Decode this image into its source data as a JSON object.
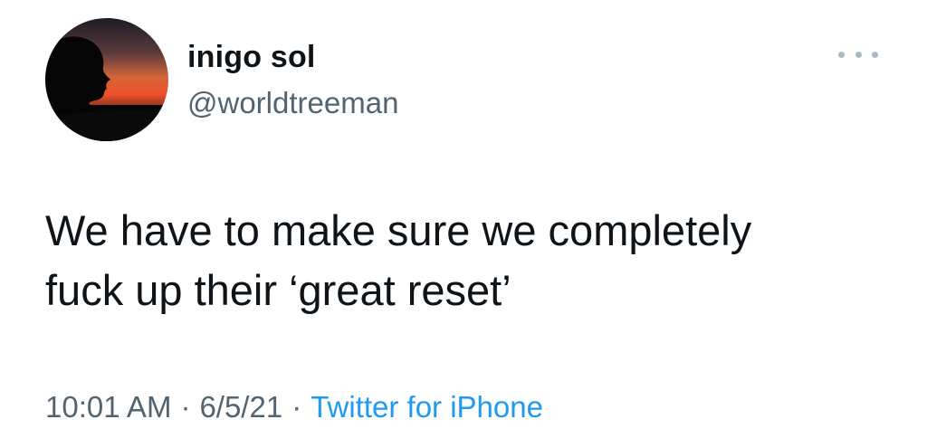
{
  "user": {
    "display_name": "inigo sol",
    "handle": "@worldtreeman",
    "avatar_icon": "silhouette-sunset-avatar"
  },
  "menu": {
    "icon": "more-options-icon"
  },
  "tweet": {
    "text_lines": [
      "We have to make sure we completely",
      "fuck up their ‘great reset’"
    ],
    "time": "10:01 AM",
    "date": "6/5/21",
    "separator": "·",
    "source": "Twitter for iPhone"
  },
  "colors": {
    "text": "#0f1419",
    "secondary": "#536471",
    "link": "#1d9bf0",
    "dots": "#aab8c2"
  }
}
